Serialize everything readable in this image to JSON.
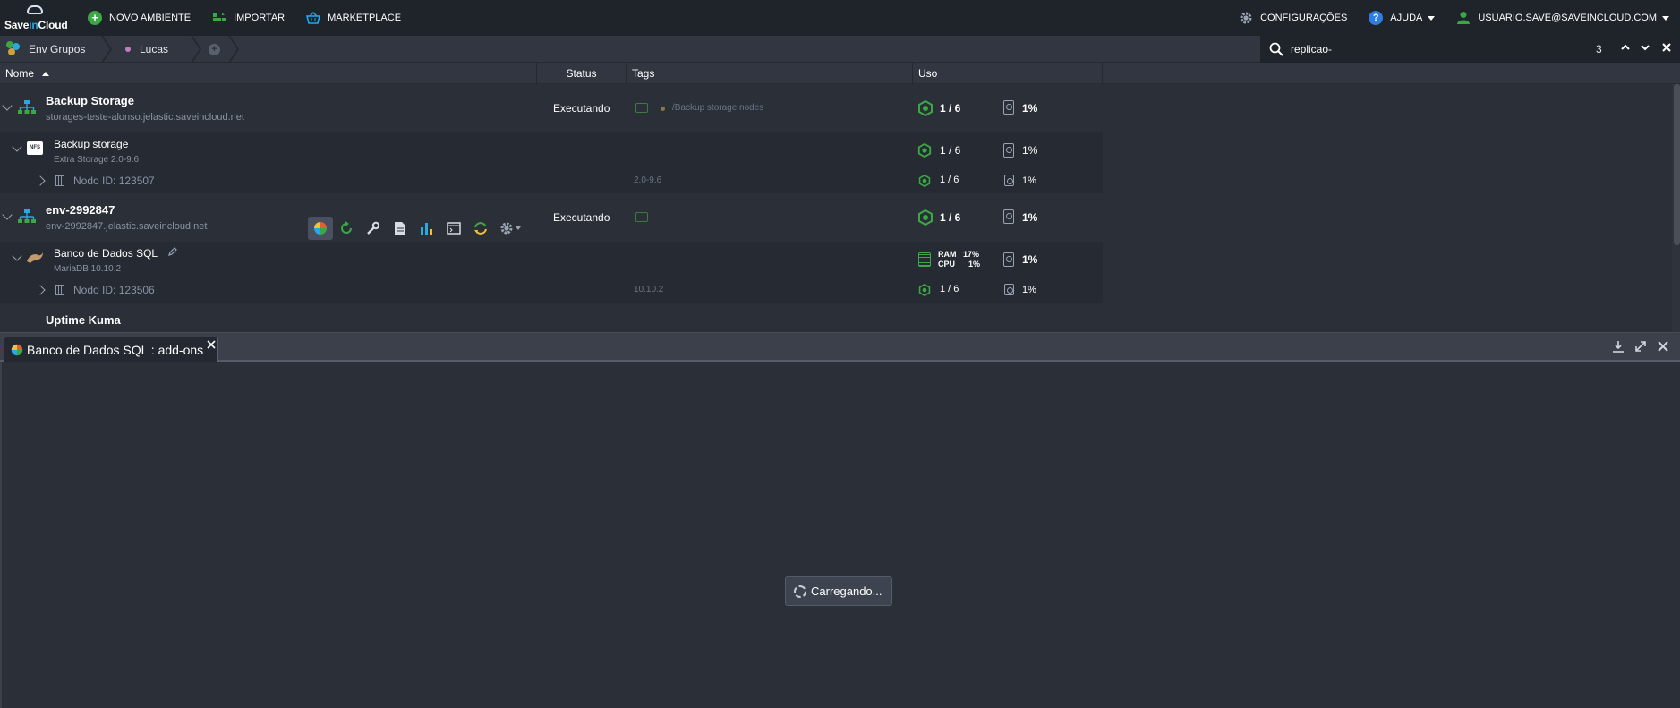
{
  "app": {
    "logo": {
      "part1": "Save",
      "part2": "in",
      "part3": "Cloud"
    }
  },
  "topbar": {
    "new_env": "NOVO AMBIENTE",
    "import": "IMPORTAR",
    "marketplace": "MARKETPLACE",
    "settings": "CONFIGURAÇÕES",
    "help": "AJUDA",
    "user": "USUARIO.SAVE@SAVEINCLOUD.COM"
  },
  "breadcrumb": {
    "root": "Env Grupos",
    "group": "Lucas"
  },
  "search": {
    "value": "replicao-",
    "count": "3"
  },
  "columns": {
    "name": "Nome",
    "status": "Status",
    "tags": "Tags",
    "usage": "Uso"
  },
  "rows": {
    "env1": {
      "name": "Backup Storage",
      "domain": "storages-teste-alonso.jelastic.saveincloud.net",
      "status": "Executando",
      "tag": "/Backup storage nodes",
      "cloudlets": "1 / 6",
      "disk": "1%"
    },
    "env1_node": {
      "name": "Backup storage",
      "version": "Extra Storage 2.0-9.6",
      "badge": "NFS",
      "cloudlets": "1 / 6",
      "disk": "1%"
    },
    "env1_nodeid": {
      "name": "Nodo ID: 123507",
      "tag": "2.0-9.6",
      "cloudlets": "1 / 6",
      "disk": "1%"
    },
    "env2": {
      "name": "env-2992847",
      "domain": "env-2992847.jelastic.saveincloud.net",
      "status": "Executando",
      "cloudlets": "1 / 6",
      "disk": "1%"
    },
    "env2_node": {
      "name": "Banco de Dados SQL",
      "version": "MariaDB 10.10.2",
      "ram_label": "RAM",
      "ram": "17%",
      "cpu_label": "CPU",
      "cpu": "1%",
      "disk": "1%"
    },
    "env2_nodeid": {
      "name": "Nodo ID: 123506",
      "tag": "10.10.2",
      "cloudlets": "1 / 6",
      "disk": "1%"
    },
    "env3": {
      "name": "Uptime Kuma"
    }
  },
  "panel": {
    "tab_title": "Banco de Dados SQL : add-ons",
    "loading": "Carregando..."
  },
  "colors": {
    "accent_green": "#3ba845",
    "accent_blue": "#27a9e1",
    "topbar_bg": "#1f232a",
    "body_bg": "#2b2f38"
  }
}
